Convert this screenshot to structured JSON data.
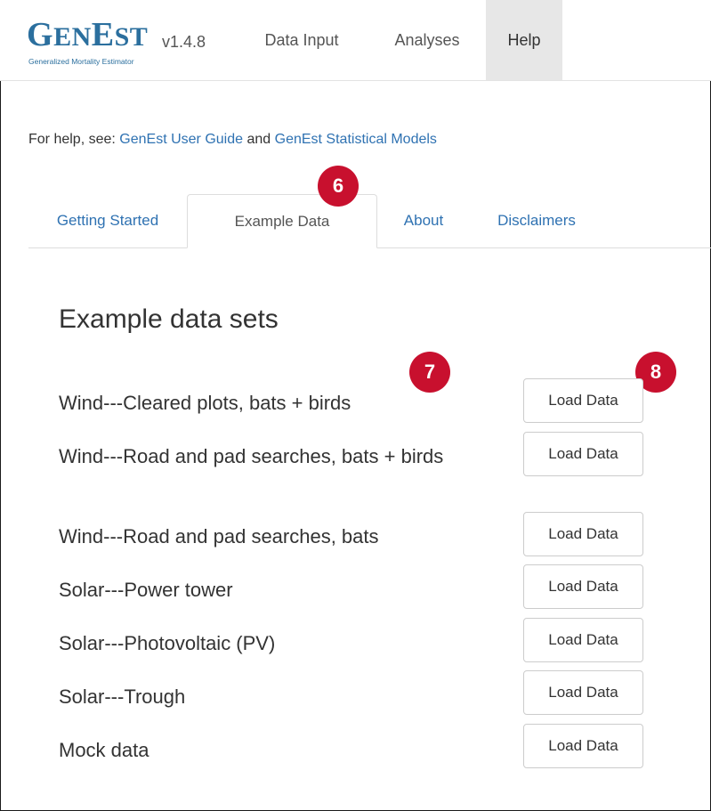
{
  "navbar": {
    "brand_name": "GENEST",
    "brand_subtitle": "Generalized Mortality Estimator",
    "version": "v1.4.8",
    "items": [
      {
        "label": "Data Input"
      },
      {
        "label": "Analyses"
      },
      {
        "label": "Help",
        "active": true
      }
    ]
  },
  "help": {
    "prefix": "For help, see:",
    "link1": "GenEst User Guide",
    "and": "and",
    "link2": "GenEst Statistical Models"
  },
  "tabs": [
    {
      "label": "Getting Started"
    },
    {
      "label": "Example Data",
      "active": true
    },
    {
      "label": "About"
    },
    {
      "label": "Disclaimers"
    }
  ],
  "badges": [
    "6",
    "7",
    "8"
  ],
  "content": {
    "title": "Example data sets",
    "button_label": "Load Data",
    "datasets": [
      "Wind---Cleared plots, bats + birds",
      "Wind---Road and pad searches, bats + birds",
      "Wind---Road and pad searches, bats",
      "Solar---Power tower",
      "Solar---Photovoltaic (PV)",
      "Solar---Trough",
      "Mock data"
    ]
  },
  "colors": {
    "badge": "#c8102e",
    "link": "#2f72b2",
    "brand": "#2b6f9e"
  }
}
